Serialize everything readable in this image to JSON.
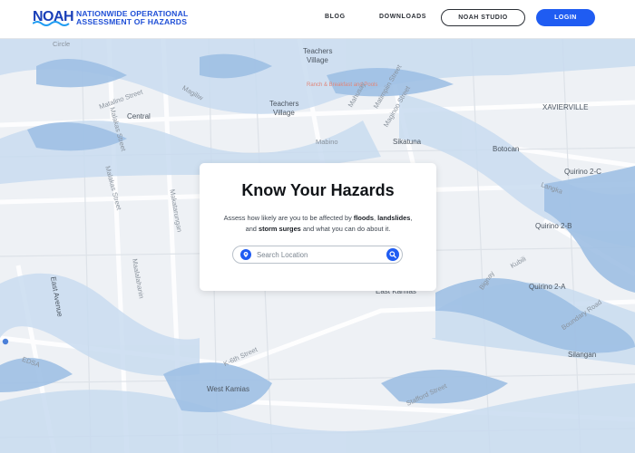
{
  "header": {
    "logo_text": "NOAH",
    "brand_line1": "NATIONWIDE OPERATIONAL",
    "brand_line2": "ASSESSMENT OF HAZARDS",
    "nav": {
      "blog": "BLOG",
      "downloads": "DOWNLOADS"
    },
    "studio_button": "NOAH STUDIO",
    "login_button": "LOGIN"
  },
  "card": {
    "title": "Know Your Hazards",
    "desc_part1": "Assess how likely are you to be affected by ",
    "desc_floods": "floods",
    "desc_sep1": ", ",
    "desc_landslides": "landslides",
    "desc_sep2": ",",
    "desc_part2": "and ",
    "desc_storm": "storm surges",
    "desc_part3": " and what you can do about it.",
    "search_placeholder": "Search Location"
  },
  "map": {
    "labels": {
      "circle": "Circle",
      "teachers_village_1": "Teachers",
      "teachers_village_1b": "Village",
      "ranch": "Ranch & Breakfast and Pools",
      "teachers_village_2": "Teachers",
      "teachers_village_2b": "Village",
      "matalino": "Matalino Street",
      "magiliw": "Magiliw",
      "central": "Central",
      "mahusay": "Mahusay",
      "matimpiin": "Matimpiin Street",
      "maginoo": "Maginoo Street",
      "xavierville": "XAVIERVILLE",
      "malakas1": "Malakas Street",
      "malakas2": "Malakas Street",
      "mabino": "Mabino",
      "sikatuna": "Sikatuna",
      "botocan": "Botocan",
      "quirino2c": "Quirino 2-C",
      "langka": "Langka",
      "quirino2b": "Quirino 2-B",
      "makatarungan": "Makatarungan",
      "maalalahanin": "Maalalahanin",
      "kubili": "Kubili",
      "bignay": "Bignay",
      "quirino2a": "Quirino 2-A",
      "east_avenue": "East Avenue",
      "east_kamias": "East Kamias",
      "k6th": "K-6th Street",
      "edsa": "EDSA",
      "west_kamias": "West Kamias",
      "silangan": "Silangan",
      "stafford": "Stafford Street",
      "boundary": "Boundary Road"
    }
  },
  "colors": {
    "brand_blue": "#1f5cf2",
    "flood_light": "#c9dcf0",
    "flood_dark": "#9fc0e4",
    "map_bg": "#eef1f5"
  }
}
